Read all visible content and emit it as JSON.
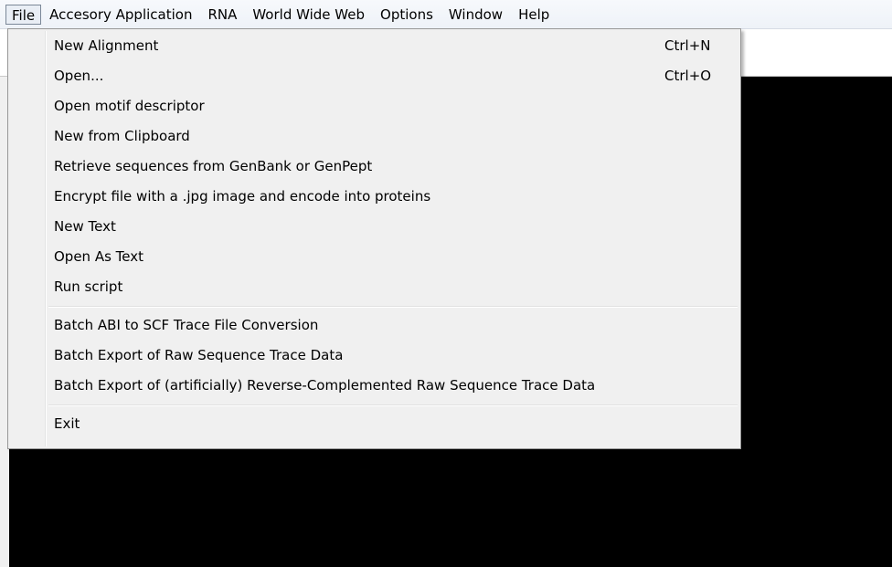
{
  "menubar": {
    "items": [
      {
        "label": "File"
      },
      {
        "label": "Accesory Application"
      },
      {
        "label": "RNA"
      },
      {
        "label": "World Wide Web"
      },
      {
        "label": "Options"
      },
      {
        "label": "Window"
      },
      {
        "label": "Help"
      }
    ]
  },
  "file_menu": {
    "group1": [
      {
        "label": "New Alignment",
        "shortcut": "Ctrl+N"
      },
      {
        "label": "Open...",
        "shortcut": "Ctrl+O"
      },
      {
        "label": "Open motif descriptor"
      },
      {
        "label": "New from Clipboard"
      },
      {
        "label": "Retrieve sequences from GenBank or GenPept"
      },
      {
        "label": "Encrypt file with a .jpg image and encode into proteins"
      },
      {
        "label": "New Text"
      },
      {
        "label": "Open As Text"
      },
      {
        "label": "Run script"
      }
    ],
    "group2": [
      {
        "label": "Batch ABI to SCF Trace File Conversion"
      },
      {
        "label": "Batch Export of Raw Sequence Trace Data"
      },
      {
        "label": "Batch Export of (artificially) Reverse-Complemented Raw Sequence Trace Data"
      }
    ],
    "group3": [
      {
        "label": "Exit"
      }
    ]
  }
}
